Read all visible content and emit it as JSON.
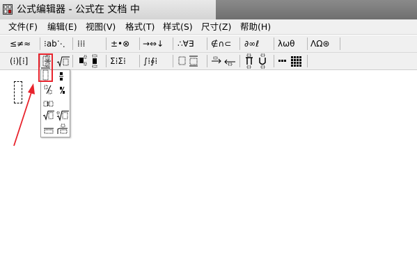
{
  "window": {
    "title": "公式编辑器 - 公式在 文档 中"
  },
  "menu": [
    {
      "label": "文件(F)"
    },
    {
      "label": "编辑(E)"
    },
    {
      "label": "视图(V)"
    },
    {
      "label": "格式(T)"
    },
    {
      "label": "样式(S)"
    },
    {
      "label": "尺寸(Z)"
    },
    {
      "label": "帮助(H)"
    }
  ],
  "toolbar_row1": [
    {
      "label": "≤≠≈",
      "icon": "relations-palette"
    },
    {
      "label": "⁝ab⋱",
      "icon": "spaces-ellipses-palette"
    },
    {
      "label": "⁞⁞⁞",
      "icon": "embellishments-palette"
    },
    {
      "label": "±•⊗",
      "icon": "operators-palette"
    },
    {
      "label": "→⇔↓",
      "icon": "arrows-palette"
    },
    {
      "label": "∴∀∃",
      "icon": "logic-palette"
    },
    {
      "label": "∉∩⊂",
      "icon": "set-theory-palette"
    },
    {
      "label": "∂∞ℓ",
      "icon": "misc-symbols-palette"
    },
    {
      "label": "λωθ",
      "icon": "greek-lowercase-palette"
    },
    {
      "label": "ΛΩ⊛",
      "icon": "greek-uppercase-palette"
    }
  ],
  "toolbar_row2": [
    {
      "label": "(⁞)[⁞]",
      "icon": "fence-templates"
    },
    {
      "label": "fraction-radical",
      "icon": "fraction-radical-templates"
    },
    {
      "label": "subscript-superscript",
      "icon": "script-templates"
    },
    {
      "label": "Σ⁞Σ⁞",
      "icon": "summation-templates"
    },
    {
      "label": "∫⁞∮⁞",
      "icon": "integral-templates"
    },
    {
      "label": "overbar-underbar",
      "icon": "bar-templates"
    },
    {
      "label": "labeled-arrows",
      "icon": "labeled-arrow-templates"
    },
    {
      "label": "products-sets",
      "icon": "product-templates"
    },
    {
      "label": "matrix",
      "icon": "matrix-templates"
    }
  ],
  "dropdown_items": [
    {
      "icon": "full-size-fraction"
    },
    {
      "icon": "small-fraction"
    },
    {
      "icon": "slash-fraction"
    },
    {
      "icon": "small-slash-fraction"
    },
    {
      "icon": "horizontal-fraction"
    },
    {
      "icon": "square-root"
    },
    {
      "icon": "nth-root"
    },
    {
      "icon": "long-division"
    },
    {
      "icon": "long-division-variant"
    }
  ],
  "annotation": {
    "color": "#e8232c"
  }
}
